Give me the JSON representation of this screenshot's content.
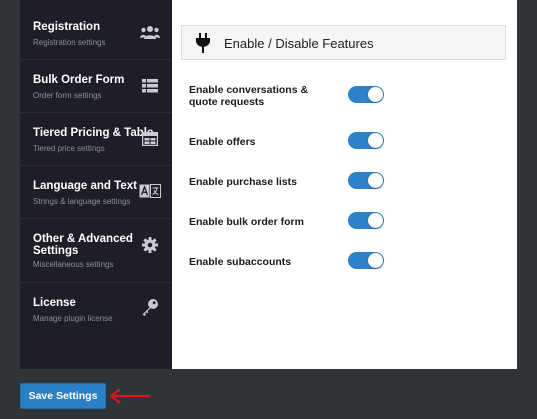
{
  "sidebar": {
    "items": [
      {
        "title": "Registration",
        "subtitle": "Registration settings",
        "icon": "users-icon"
      },
      {
        "title": "Bulk Order Form",
        "subtitle": "Order form settings",
        "icon": "table-list-icon"
      },
      {
        "title": "Tiered Pricing & Table",
        "subtitle": "Tiered price settings",
        "icon": "table-grid-icon"
      },
      {
        "title": "Language and Text",
        "subtitle": "Strings & language settings",
        "icon": "translate-icon"
      },
      {
        "title": "Other & Advanced Settings",
        "subtitle": "Miscellaneous settings",
        "icon": "gear-icon"
      },
      {
        "title": "License",
        "subtitle": "Manage plugin license",
        "icon": "key-icon"
      }
    ]
  },
  "section": {
    "title": "Enable / Disable Features",
    "icon": "plug-icon"
  },
  "features": [
    {
      "label": "Enable conversations & quote requests",
      "enabled": true
    },
    {
      "label": "Enable offers",
      "enabled": true
    },
    {
      "label": "Enable purchase lists",
      "enabled": true
    },
    {
      "label": "Enable bulk order form",
      "enabled": true
    },
    {
      "label": "Enable subaccounts",
      "enabled": true
    }
  ],
  "save_button": {
    "label": "Save Settings"
  },
  "colors": {
    "sidebar_bg": "#1e1f26",
    "accent": "#2d82c9",
    "arrow": "#e0141e",
    "page_bg": "#2e3438"
  }
}
